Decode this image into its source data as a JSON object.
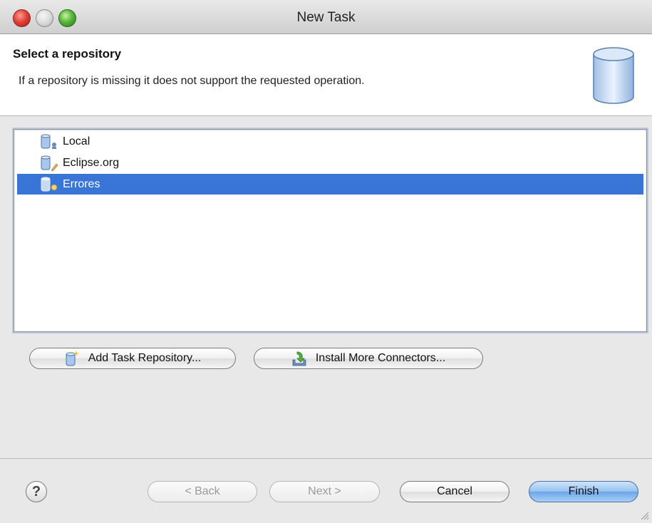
{
  "window": {
    "title": "New Task"
  },
  "header": {
    "title": "Select a repository",
    "description": "If a repository is missing it does not support the requested operation.",
    "icon": "repository-cylinder-icon"
  },
  "repositories": [
    {
      "label": "Local",
      "icon": "local-repository-icon",
      "selected": false
    },
    {
      "label": "Eclipse.org",
      "icon": "eclipse-repository-icon",
      "selected": false
    },
    {
      "label": "Errores",
      "icon": "errores-repository-icon",
      "selected": true
    }
  ],
  "actions": {
    "add_repository": "Add Task Repository...",
    "install_connectors": "Install More Connectors..."
  },
  "footer": {
    "help": "?",
    "back": "< Back",
    "next": "Next >",
    "cancel": "Cancel",
    "finish": "Finish"
  },
  "colors": {
    "selection": "#3875d7",
    "default_button": "#6aa6e8"
  }
}
